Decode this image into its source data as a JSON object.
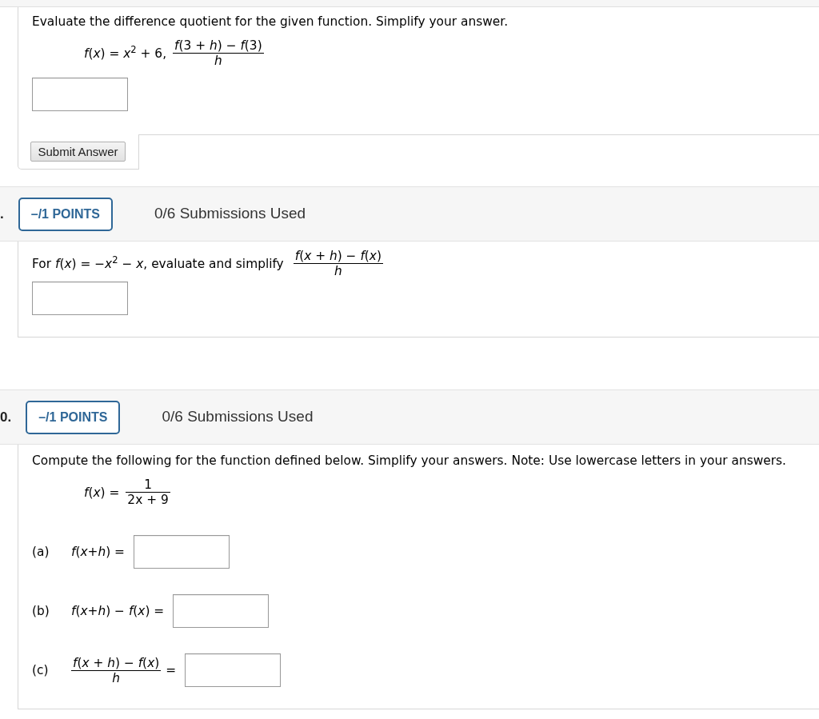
{
  "questions": [
    {
      "body": [
        {
          "kind": "paragraph",
          "text": "Evaluate the difference quotient for the given function. Simplify your answer."
        },
        {
          "kind": "display",
          "segments": [
            {
              "kind": "text",
              "text": "*f*(*x*) = *x*$^{2}$ + 6,"
            },
            {
              "kind": "fraction",
              "numerator": "*f*(3 + *h*) − *f*(3)",
              "denominator": "*h*"
            }
          ]
        },
        {
          "kind": "answer"
        }
      ],
      "submit_button": "Submit Answer"
    },
    {
      "header": {
        "number": ".",
        "points": "–/1 POINTS",
        "submissions": "0/6 Submissions Used"
      },
      "body": [
        {
          "kind": "line",
          "segments": [
            {
              "kind": "text",
              "text": "For *f*(*x*) = −*x*$^{2}$ − *x*, evaluate and simplify"
            },
            {
              "kind": "fraction",
              "numerator": "*f*(*x* + *h*) − *f*(*x*)",
              "denominator": "*h*"
            }
          ]
        },
        {
          "kind": "answer"
        }
      ]
    },
    {
      "header": {
        "number": "0.",
        "points": "–/1 POINTS",
        "submissions": "0/6 Submissions Used"
      },
      "body": [
        {
          "kind": "paragraph",
          "text": "Compute the following for the function defined below. Simplify your answers. Note: Use lowercase letters in your answers."
        },
        {
          "kind": "display",
          "segments": [
            {
              "kind": "text",
              "text": "*f*(*x*) ="
            },
            {
              "kind": "fraction",
              "numerator": "1",
              "denominator": "2x + 9"
            }
          ]
        },
        {
          "kind": "part",
          "label": "(a)",
          "segments": [
            {
              "kind": "text",
              "text": "*f*(*x*+*h*) ="
            }
          ]
        },
        {
          "kind": "part",
          "label": "(b)",
          "segments": [
            {
              "kind": "text",
              "text": "*f*(*x*+*h*) − *f*(*x*) ="
            }
          ]
        },
        {
          "kind": "part",
          "label": "(c)",
          "segments": [
            {
              "kind": "fraction",
              "numerator": "*f*(*x* + *h*) − *f*(*x*)",
              "denominator": "*h*"
            },
            {
              "kind": "text",
              "text": "="
            }
          ]
        }
      ]
    }
  ]
}
